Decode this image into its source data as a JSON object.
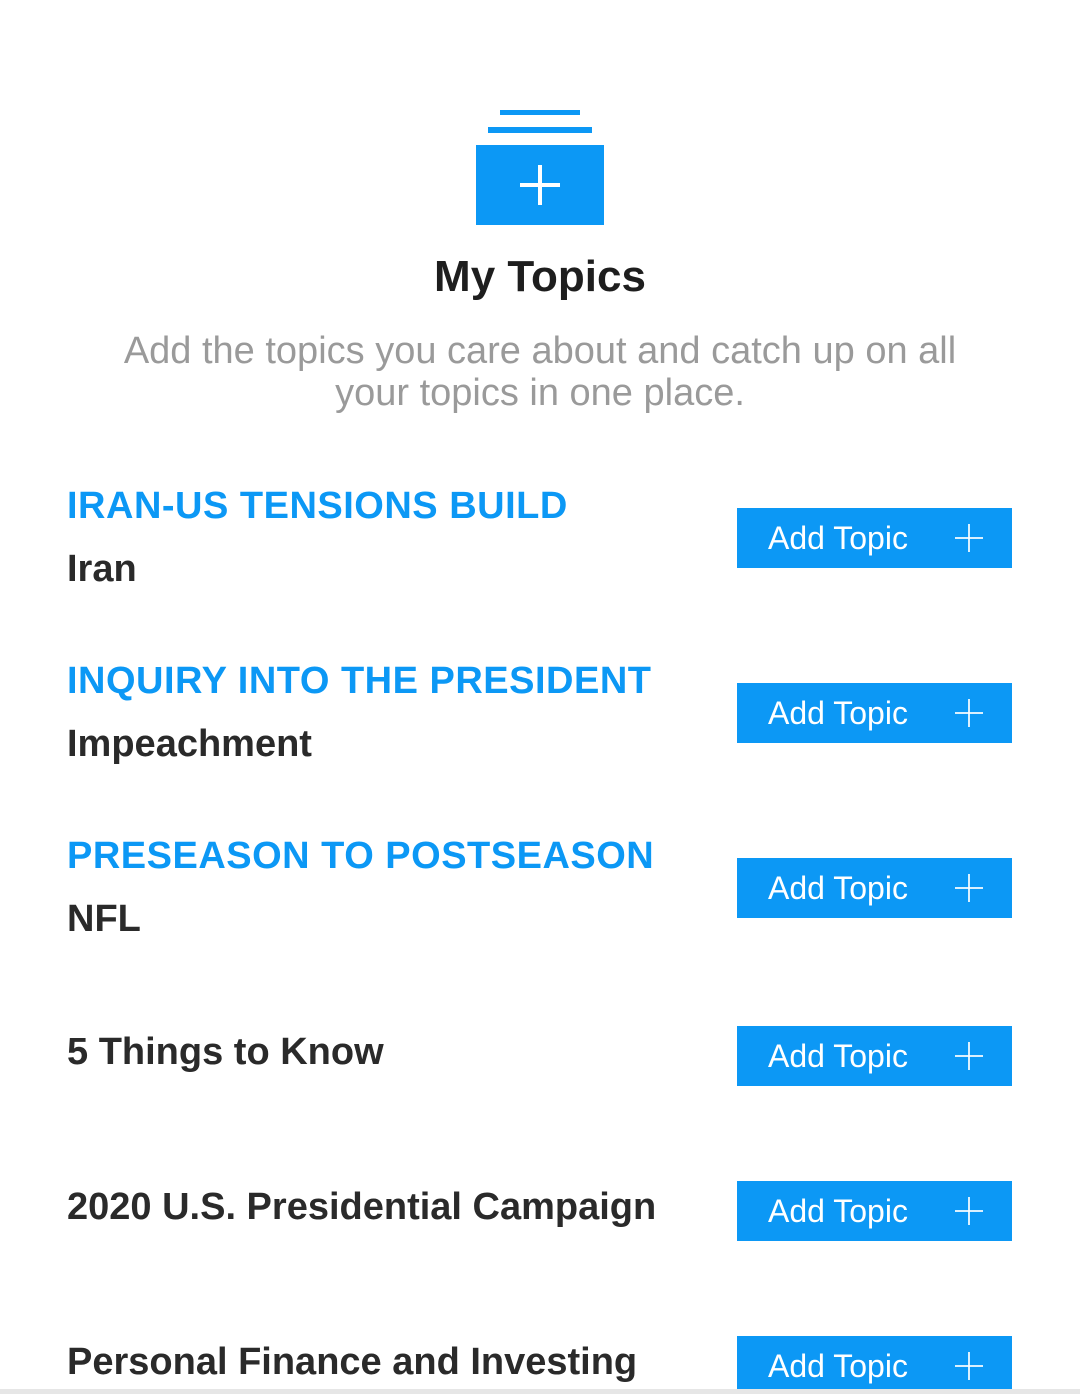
{
  "header": {
    "icon": "add-topic-stack-icon",
    "title": "My Topics",
    "subtitle": "Add the topics you care about and catch up on all your topics in one place."
  },
  "topics": [
    {
      "kicker": "IRAN-US TENSIONS BUILD",
      "name": "Iran",
      "button": "Add Topic"
    },
    {
      "kicker": "INQUIRY INTO THE PRESIDENT",
      "name": "Impeachment",
      "button": "Add Topic"
    },
    {
      "kicker": "PRESEASON TO POSTSEASON",
      "name": "NFL",
      "button": "Add Topic"
    },
    {
      "kicker": "",
      "name": "5 Things to Know",
      "button": "Add Topic"
    },
    {
      "kicker": "",
      "name": "2020 U.S. Presidential Campaign",
      "button": "Add Topic"
    },
    {
      "kicker": "",
      "name": "Personal Finance and Investing",
      "button": "Add Topic"
    }
  ],
  "colors": {
    "accent": "#0c98f5",
    "title_text": "#1e1e1e",
    "subtitle_text": "#9a9a9a"
  }
}
